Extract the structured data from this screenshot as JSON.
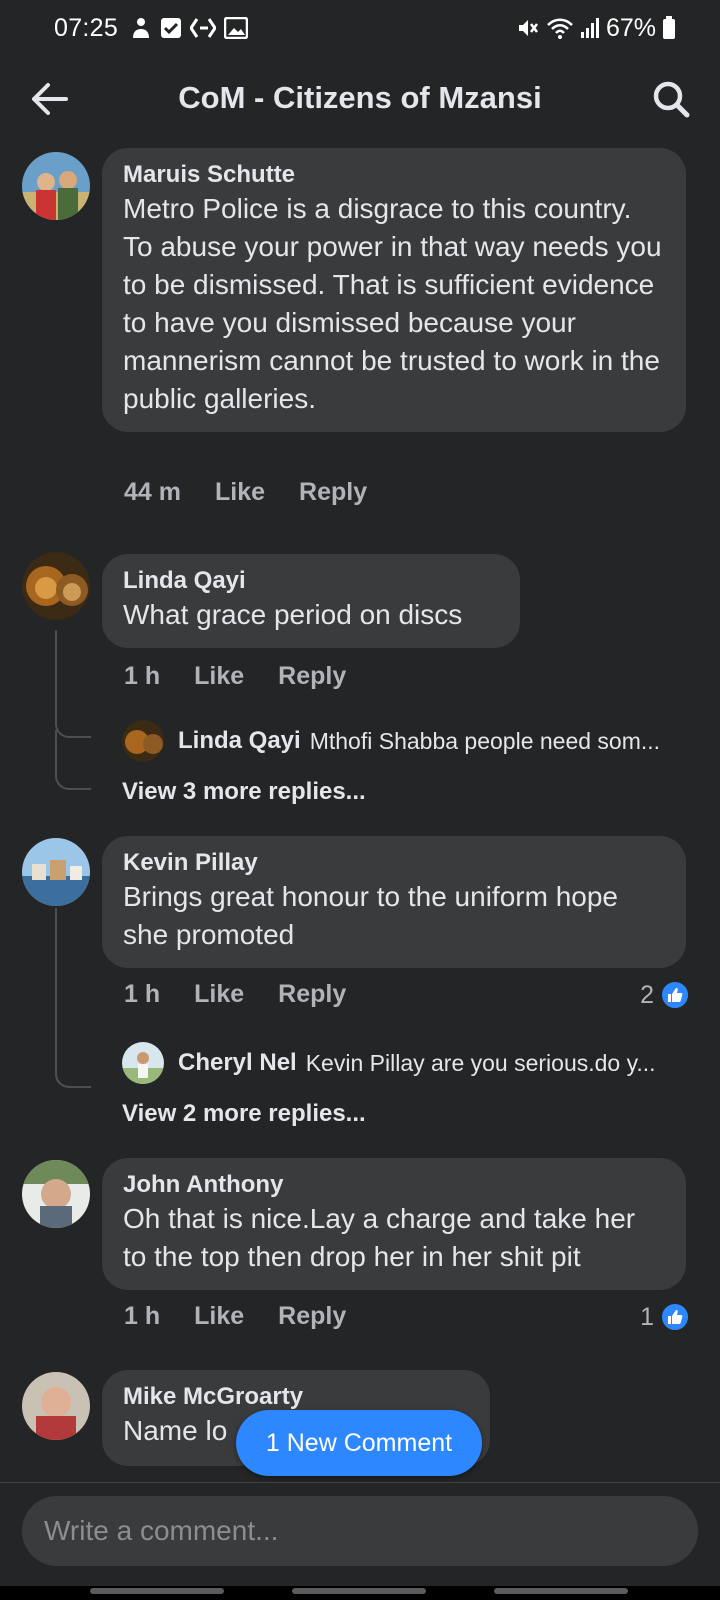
{
  "status_bar": {
    "time": "07:25",
    "battery": "67%",
    "icons": [
      "people-icon",
      "checkbox-icon",
      "diamond-arrow-icon",
      "gallery-icon",
      "mute-icon",
      "wifi-icon",
      "signal-icon",
      "battery-icon"
    ]
  },
  "header": {
    "title": "CoM - Citizens of Mzansi",
    "back_icon": "back-arrow-icon",
    "search_icon": "search-icon"
  },
  "comments": [
    {
      "author": "Maruis Schutte",
      "text": "Metro Police is a disgrace to this country. To abuse your power in that way needs you to be dismissed. That is sufficient evidence to have you dismissed because your mannerism cannot be trusted to work in the public galleries.",
      "time": "44 m",
      "like_label": "Like",
      "reply_label": "Reply"
    },
    {
      "author": "Linda Qayi",
      "text": "What grace period on discs",
      "time": "1 h",
      "like_label": "Like",
      "reply_label": "Reply",
      "reply_preview": {
        "author": "Linda Qayi",
        "text": "Mthofi Shabba people need som..."
      },
      "view_more": "View 3 more replies..."
    },
    {
      "author": "Kevin Pillay",
      "text": "Brings great honour to the uniform hope she promoted",
      "time": "1 h",
      "like_label": "Like",
      "reply_label": "Reply",
      "reaction_count": "2",
      "reply_preview": {
        "author": "Cheryl Nel",
        "text": "Kevin Pillay are you serious.do y..."
      },
      "view_more": "View 2 more replies..."
    },
    {
      "author": "John Anthony",
      "text": "Oh that is nice.Lay a charge and take her to the top then drop her in her shit pit",
      "time": "1 h",
      "like_label": "Like",
      "reply_label": "Reply",
      "reaction_count": "1"
    },
    {
      "author": "Mike McGroarty",
      "text": "Name lo"
    }
  ],
  "new_comment_label": "1 New Comment",
  "composer": {
    "placeholder": "Write a comment..."
  },
  "colors": {
    "background": "#242526",
    "bubble": "#3a3b3c",
    "accent": "#2d88ff",
    "secondary_text": "#b0b3b8"
  }
}
